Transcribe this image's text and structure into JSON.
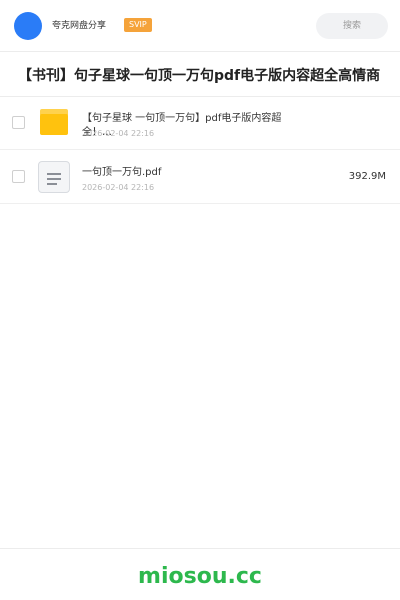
{
  "header": {
    "user_name": "夸克网盘分享",
    "badge": "SVIP",
    "search_label": "搜索"
  },
  "share": {
    "title": "【书刊】句子星球一句顶一万句pdf电子版内容超全高情商"
  },
  "files": [
    {
      "name": "【句子星球 一句顶一万句】pdf电子版内容超全！…",
      "date": "2026-02-04 22:16",
      "size": "",
      "icon": "folder-icon"
    },
    {
      "name": "一句顶一万句.pdf",
      "date": "2026-02-04 22:16",
      "size": "392.9M",
      "icon": "document-icon"
    }
  ],
  "footer": {
    "watermark": "miosou.cc"
  },
  "colors": {
    "accent": "#2a7cf7",
    "svip": "#f5a33a",
    "folder": "#ffc20e",
    "brand": "#2db84d"
  }
}
